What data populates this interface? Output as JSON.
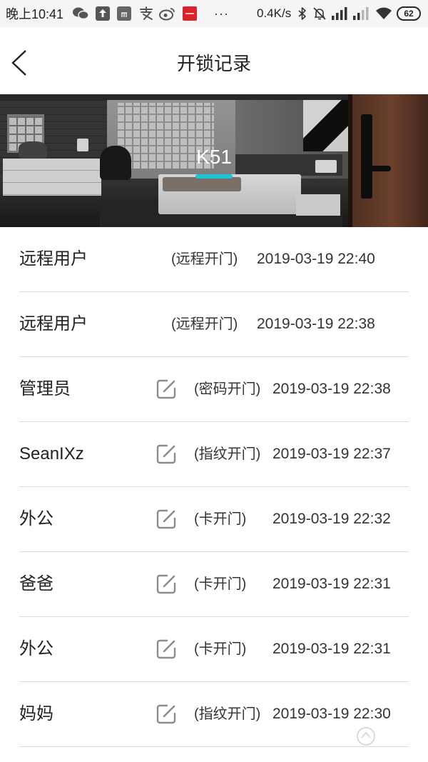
{
  "status_bar": {
    "time": "晚上10:41",
    "overflow": "···",
    "net_speed": "0.4K/s",
    "battery_level": "62",
    "notification_icons": [
      "wechat-icon",
      "upload-icon",
      "mi-icon",
      "alipay-icon",
      "weibo-icon",
      "red-app-icon"
    ],
    "system_icons": [
      "bluetooth-icon",
      "mute-icon",
      "signal-icon",
      "signal-icon",
      "wifi-icon",
      "battery-icon"
    ]
  },
  "header": {
    "title": "开锁记录",
    "back_icon": "chevron-left-icon"
  },
  "banner": {
    "device_name": "K51",
    "indicator_color": "#1fc3d6"
  },
  "records": [
    {
      "user": "远程用户",
      "has_edit_icon": false,
      "method": "(远程开门)",
      "time": "2019-03-19 22:40"
    },
    {
      "user": "远程用户",
      "has_edit_icon": false,
      "method": "(远程开门)",
      "time": "2019-03-19 22:38"
    },
    {
      "user": "管理员",
      "has_edit_icon": true,
      "method": "(密码开门)",
      "time": "2019-03-19 22:38"
    },
    {
      "user": "SeanIXz",
      "has_edit_icon": true,
      "method": "(指纹开门)",
      "time": "2019-03-19 22:37"
    },
    {
      "user": "外公",
      "has_edit_icon": true,
      "method": "(卡开门)",
      "time": "2019-03-19 22:32"
    },
    {
      "user": "爸爸",
      "has_edit_icon": true,
      "method": "(卡开门)",
      "time": "2019-03-19 22:31"
    },
    {
      "user": "外公",
      "has_edit_icon": true,
      "method": "(卡开门)",
      "time": "2019-03-19 22:31"
    },
    {
      "user": "妈妈",
      "has_edit_icon": true,
      "method": "(指纹开门)",
      "time": "2019-03-19 22:30"
    }
  ],
  "colors": {
    "status_bar_bg": "#f5f5f5",
    "text": "#222222",
    "secondary_text": "#333333",
    "divider": "#dcdcdc",
    "edit_icon": "#8c8c8c",
    "accent": "#1fc3d6"
  }
}
